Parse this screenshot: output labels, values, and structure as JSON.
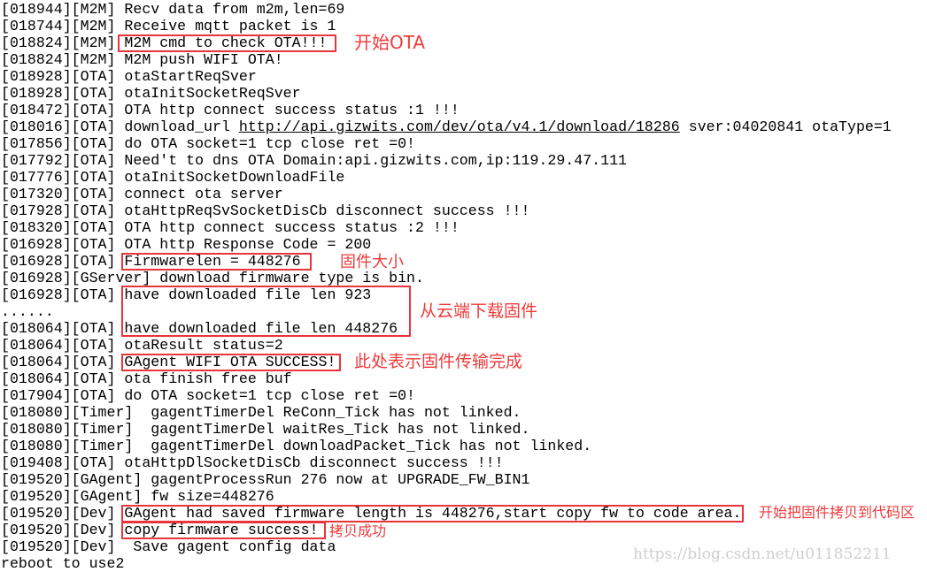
{
  "log_lines": [
    "[018944][M2M] Recv data from m2m,len=69",
    "[018744][M2M] Receive mqtt packet is 1",
    "[018824][M2M] M2M cmd to check OTA!!!",
    "[018824][M2M] M2M push WIFI OTA!",
    "[018928][OTA] otaStartReqSver",
    "[018928][OTA] otaInitSocketReqSver",
    "[018472][OTA] OTA http connect success status :1 !!!",
    {
      "prefix": "[018016][OTA] download_url ",
      "url": "http://api.gizwits.com/dev/ota/v4.1/download/18286",
      "suffix": " sver:04020841 otaType=1"
    },
    "[017856][OTA] do OTA socket=1 tcp close ret =0!",
    "[017792][OTA] Need't to dns OTA Domain:api.gizwits.com,ip:119.29.47.111",
    "[017776][OTA] otaInitSocketDownloadFile",
    "[017320][OTA] connect ota server",
    "[017928][OTA] otaHttpReqSvSocketDisCb disconnect success !!!",
    "[018320][OTA] OTA http connect success status :2 !!!",
    "[016928][OTA] OTA http Response Code = 200",
    "[016928][OTA] Firmwarelen = 448276",
    "[016928][GServer] download firmware type is bin.",
    "[016928][OTA] have downloaded file len 923",
    "......",
    "[018064][OTA] have downloaded file len 448276",
    "[018064][OTA] otaResult status=2",
    "[018064][OTA] GAgent WIFI OTA SUCCESS!",
    "[018064][OTA] ota finish free buf",
    "[017904][OTA] do OTA socket=1 tcp close ret =0!",
    "[018080][Timer]  gagentTimerDel ReConn_Tick has not linked.",
    "[018080][Timer]  gagentTimerDel waitRes_Tick has not linked.",
    "[018080][Timer]  gagentTimerDel downloadPacket_Tick has not linked.",
    "[019408][OTA] otaHttpDlSocketDisCb disconnect success !!!",
    "[019520][GAgent] gagentProcessRun 276 now at UPGRADE_FW_BIN1",
    "[019520][GAgent] fw size=448276",
    "[019520][Dev] GAgent had saved firmware length is 448276,start copy fw to code area.",
    "[019520][Dev] copy firmware success!",
    "[019520][Dev]  Save gagent config data",
    "reboot to use2"
  ],
  "annotations": [
    {
      "text": "开始OTA"
    },
    {
      "text": "固件大小"
    },
    {
      "text": "从云端下载固件"
    },
    {
      "text": "此处表示固件传输完成"
    },
    {
      "text": "开始把固件拷贝到代码区"
    },
    {
      "text": "拷贝成功"
    }
  ],
  "watermark": "https://blog.csdn.net/u011852211",
  "colors": {
    "annotation": "#f03a3a",
    "text": "#000000",
    "watermark": "#cfcfcf"
  }
}
